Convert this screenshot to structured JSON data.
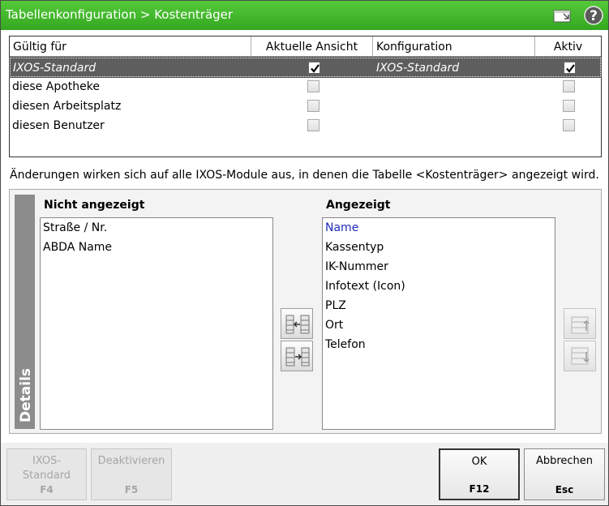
{
  "window": {
    "title": "Tabellenkonfiguration > Kostenträger"
  },
  "titlebar_icons": [
    "window-icon",
    "help-icon"
  ],
  "config_table": {
    "headers": {
      "valid_for": "Gültig für",
      "current_view": "Aktuelle Ansicht",
      "configuration": "Konfiguration",
      "active": "Aktiv"
    },
    "rows": [
      {
        "valid_for": "IXOS-Standard",
        "current_view": true,
        "configuration": "IXOS-Standard",
        "active": true,
        "selected": true
      },
      {
        "valid_for": "diese Apotheke",
        "current_view": false,
        "configuration": "",
        "active": false
      },
      {
        "valid_for": "diesen Arbeitsplatz",
        "current_view": false,
        "configuration": "",
        "active": false
      },
      {
        "valid_for": "diesen Benutzer",
        "current_view": false,
        "configuration": "",
        "active": false
      }
    ]
  },
  "info_text": "Änderungen wirken sich auf alle IXOS-Module aus, in denen die Tabelle <Kostenträger> angezeigt wird.",
  "details": {
    "tab_label": "Details",
    "hidden_label": "Nicht angezeigt",
    "shown_label": "Angezeigt",
    "hidden_items": [
      "Straße / Nr.",
      "ABDA Name"
    ],
    "shown_items": [
      "Name",
      "Kassentyp",
      "IK-Nummer",
      "Infotext (Icon)",
      "PLZ",
      "Ort",
      "Telefon"
    ]
  },
  "footer": {
    "standard": {
      "line1": "IXOS-",
      "line2": "Standard",
      "key": "F4"
    },
    "deactivate": {
      "label": "Deaktivieren",
      "key": "F5"
    },
    "ok": {
      "label": "OK",
      "key": "F12"
    },
    "cancel": {
      "label": "Abbrechen",
      "key": "Esc"
    }
  }
}
